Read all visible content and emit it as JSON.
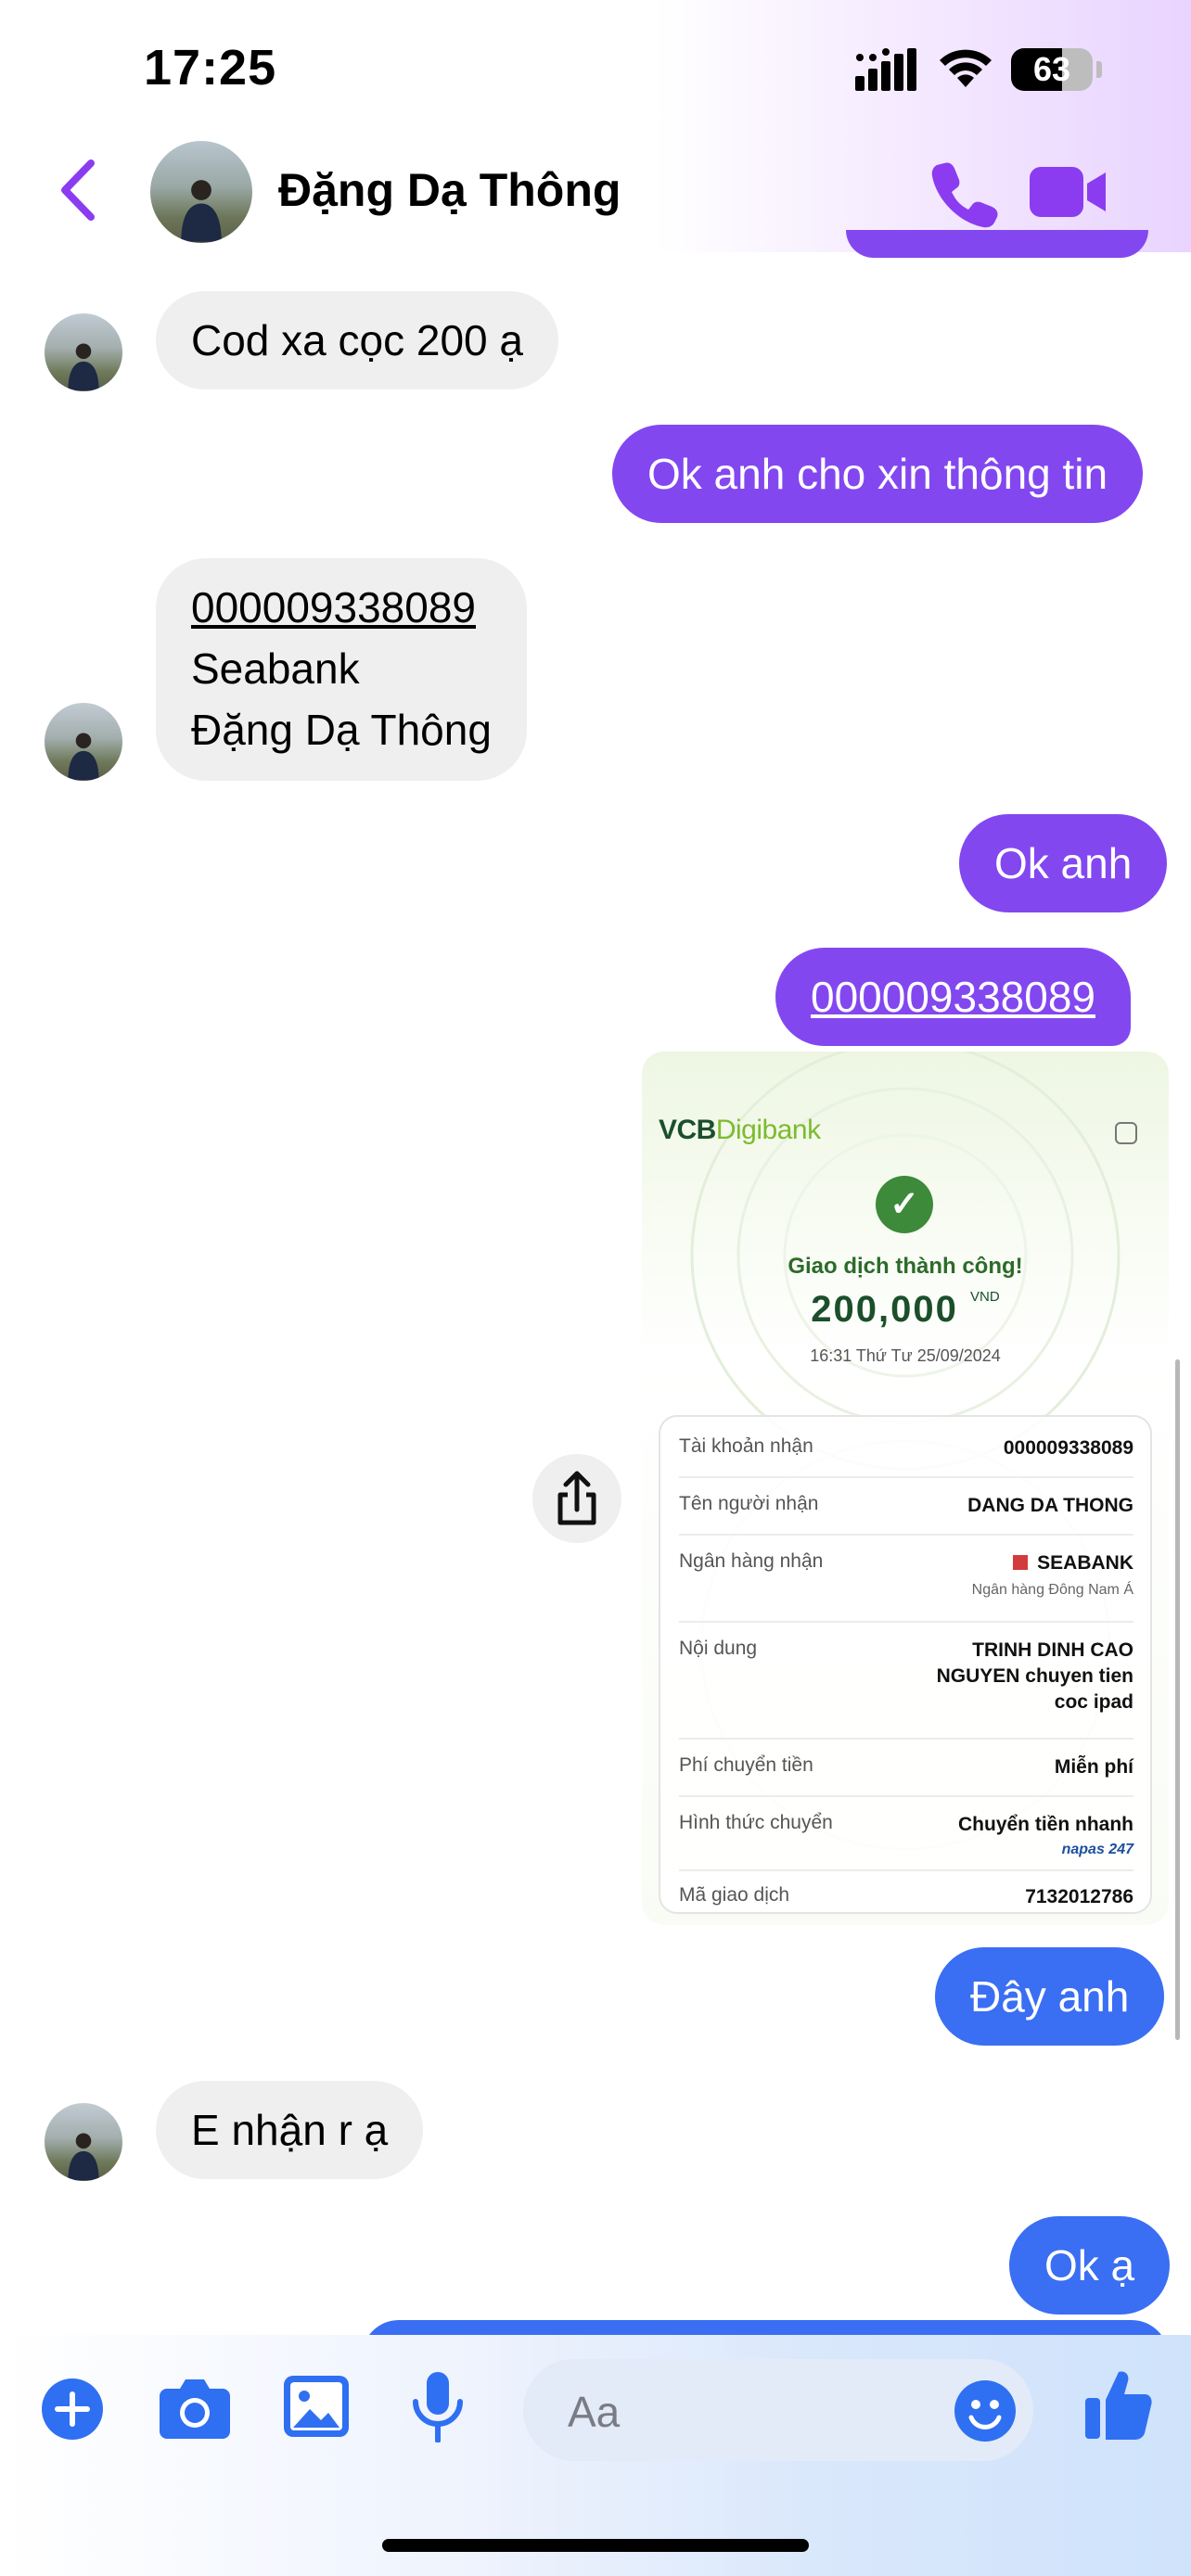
{
  "status_bar": {
    "time": "17:25",
    "battery": "63",
    "icons": [
      "cellular-signal-icon",
      "wifi-icon",
      "battery-icon"
    ]
  },
  "header": {
    "contact_name": "Đặng Dạ Thông",
    "icons": [
      "back-chevron-icon",
      "phone-icon",
      "video-camera-icon"
    ]
  },
  "messages": [
    {
      "direction": "incoming",
      "text": "Cod xa cọc 200 ạ"
    },
    {
      "direction": "outgoing",
      "text": "Ok anh cho xin thông tin"
    },
    {
      "direction": "incoming",
      "lines": [
        "000009338089",
        "Seabank",
        "Đặng Dạ Thông"
      ]
    },
    {
      "direction": "outgoing",
      "text": "Ok anh"
    },
    {
      "direction": "outgoing",
      "text": "000009338089"
    },
    {
      "direction": "outgoing",
      "text": "Đây anh"
    },
    {
      "direction": "incoming",
      "text": "E nhận r ạ"
    },
    {
      "direction": "outgoing",
      "text": "Ok ạ"
    }
  ],
  "receipt": {
    "logo_vcb": "VCB",
    "logo_digibank": "Digibank",
    "status": "Giao dịch thành công!",
    "amount": "200,000",
    "currency": "VND",
    "datetime": "16:31 Thứ Tư 25/09/2024",
    "rows": [
      {
        "label": "Tài khoản nhận",
        "value": "000009338089"
      },
      {
        "label": "Tên người nhận",
        "value": "DANG DA THONG"
      },
      {
        "label": "Ngân hàng nhận",
        "value": "SEABANK",
        "sub": "Ngân hàng Đông Nam Á"
      },
      {
        "label": "Nội dung",
        "value_lines": [
          "TRINH DINH CAO",
          "NGUYEN chuyen tien",
          "coc ipad"
        ]
      },
      {
        "label": "Phí chuyển tiền",
        "value": "Miễn phí"
      },
      {
        "label": "Hình thức chuyển",
        "value": "Chuyển tiền nhanh",
        "sub": "napas 247"
      },
      {
        "label": "Mã giao dịch",
        "value": "7132012786"
      }
    ]
  },
  "composer": {
    "placeholder": "Aa",
    "icons": [
      "plus-icon",
      "camera-icon",
      "gallery-icon",
      "microphone-icon",
      "emoji-icon",
      "thumbs-up-icon"
    ]
  },
  "colors": {
    "accent_purple": "#8347f0",
    "accent_blue": "#3a6ef3",
    "incoming_bubble": "#efefef",
    "vcb_green": "#1b4f2b"
  }
}
